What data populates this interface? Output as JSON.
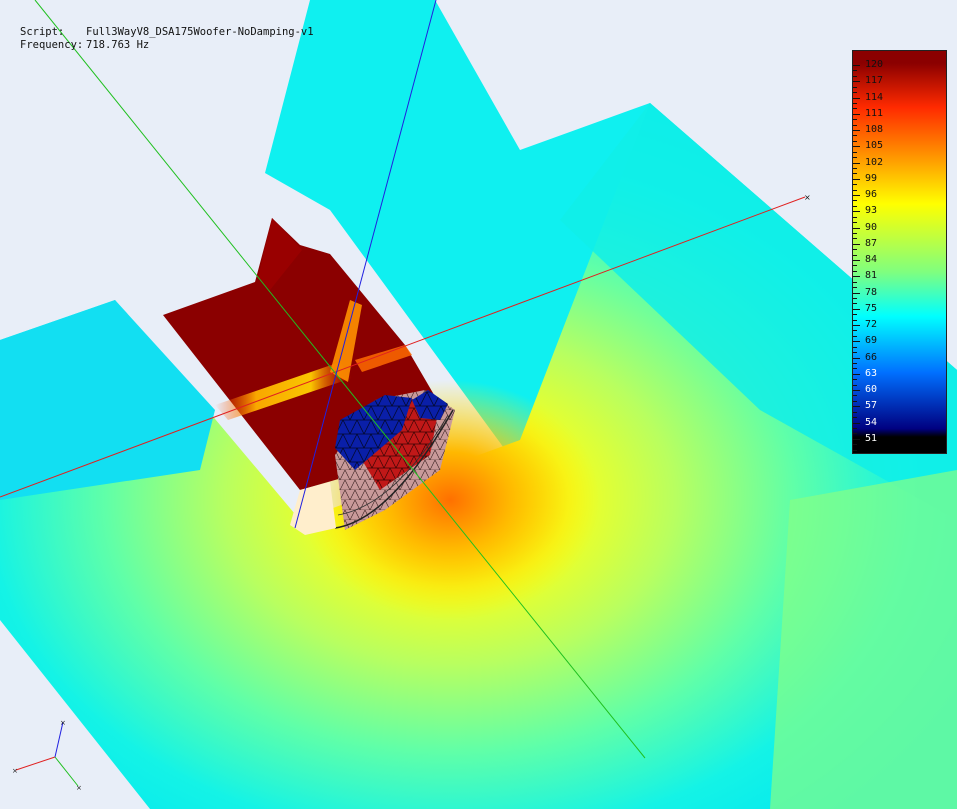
{
  "info": {
    "script_label": "Script:",
    "script_value": "Full3WayV8_DSA175Woofer-NoDamping-v1",
    "frequency_label": "Frequency:",
    "frequency_value": "718.763 Hz"
  },
  "legend": {
    "labels": [
      "120",
      "117",
      "114",
      "111",
      "108",
      "105",
      "102",
      "99",
      "96",
      "93",
      "90",
      "87",
      "84",
      "81",
      "78",
      "75",
      "72",
      "69",
      "66",
      "63",
      "60",
      "57",
      "54",
      "51"
    ],
    "colors": {
      "max": "#8b0000",
      "high": "#ff2a00",
      "upper": "#ffa500",
      "mid": "#ffff00",
      "lower_mid": "#7fff7f",
      "low_mid": "#00ffff",
      "low": "#0070ff",
      "min": "#000080"
    }
  },
  "scene": {
    "axis_colors": {
      "x": "#e02020",
      "y": "#20c020",
      "z": "#2020e0"
    }
  }
}
